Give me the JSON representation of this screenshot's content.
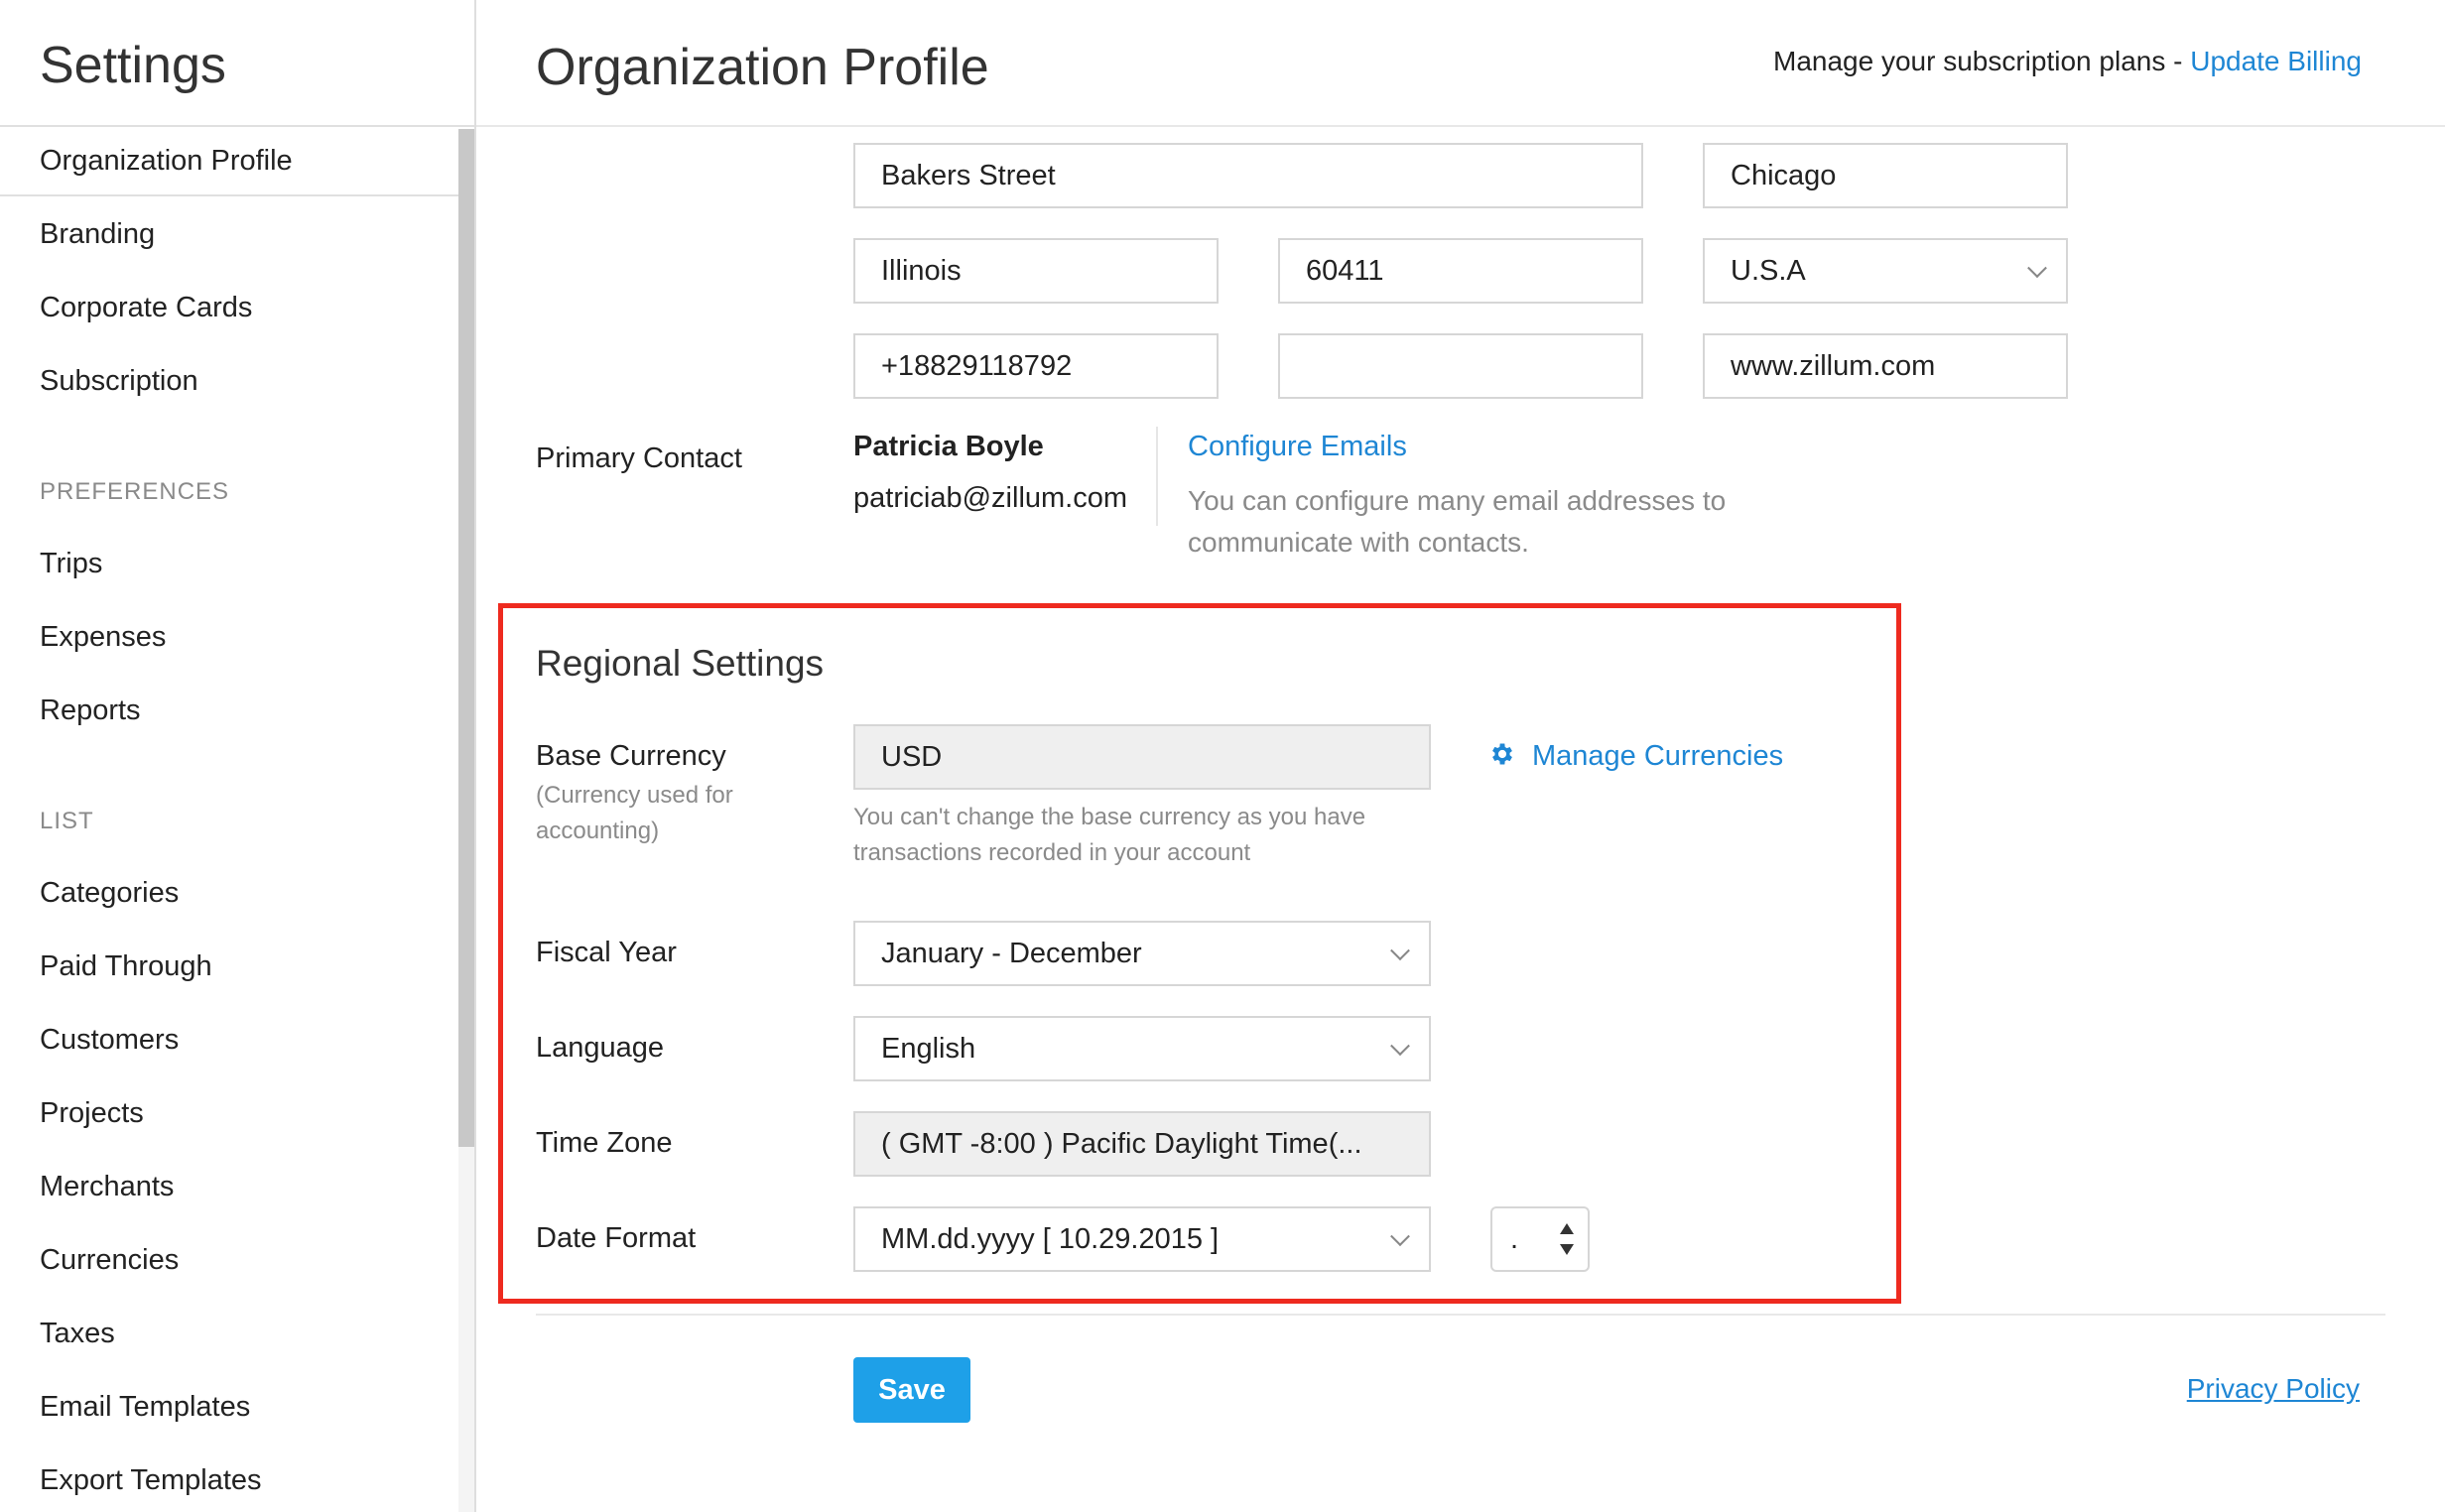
{
  "sidebar": {
    "title": "Settings",
    "items_top": [
      "Organization Profile",
      "Branding",
      "Corporate Cards",
      "Subscription"
    ],
    "preferences_heading": "PREFERENCES",
    "items_preferences": [
      "Trips",
      "Expenses",
      "Reports"
    ],
    "list_heading": "LIST",
    "items_list": [
      "Categories",
      "Paid Through",
      "Customers",
      "Projects",
      "Merchants",
      "Currencies",
      "Taxes",
      "Email Templates",
      "Export Templates"
    ]
  },
  "header": {
    "title": "Organization Profile",
    "billing_text": "Manage your subscription plans - ",
    "billing_link": "Update Billing"
  },
  "address": {
    "street": "Bakers Street",
    "city": "Chicago",
    "state": "Illinois",
    "zip": "60411",
    "country": "U.S.A",
    "phone": "+18829118792",
    "fax": "",
    "website": "www.zillum.com"
  },
  "primary_contact": {
    "label": "Primary Contact",
    "name": "Patricia Boyle",
    "email": "patriciab@zillum.com",
    "configure_link": "Configure Emails",
    "configure_hint_line1": "You can configure many email addresses to",
    "configure_hint_line2": "communicate with contacts."
  },
  "regional": {
    "title": "Regional Settings",
    "base_currency_label": "Base Currency",
    "base_currency_sub_line1": "(Currency used for",
    "base_currency_sub_line2": "accounting)",
    "base_currency_value": "USD",
    "base_currency_hint_line1": "You can't change the base currency as you have",
    "base_currency_hint_line2": "transactions recorded in your account",
    "manage_currencies": "Manage Currencies",
    "fiscal_year_label": "Fiscal Year",
    "fiscal_year_value": "January - December",
    "language_label": "Language",
    "language_value": "English",
    "time_zone_label": "Time Zone",
    "time_zone_value": "( GMT -8:00 ) Pacific Daylight Time(...",
    "date_format_label": "Date Format",
    "date_format_value": "MM.dd.yyyy [ 10.29.2015 ]",
    "date_separator_value": "."
  },
  "footer": {
    "save_label": "Save",
    "privacy_label": "Privacy Policy"
  },
  "colors": {
    "accent": "#1e86d4",
    "highlight": "#ee2a1f",
    "save_button": "#1ea0e8"
  }
}
